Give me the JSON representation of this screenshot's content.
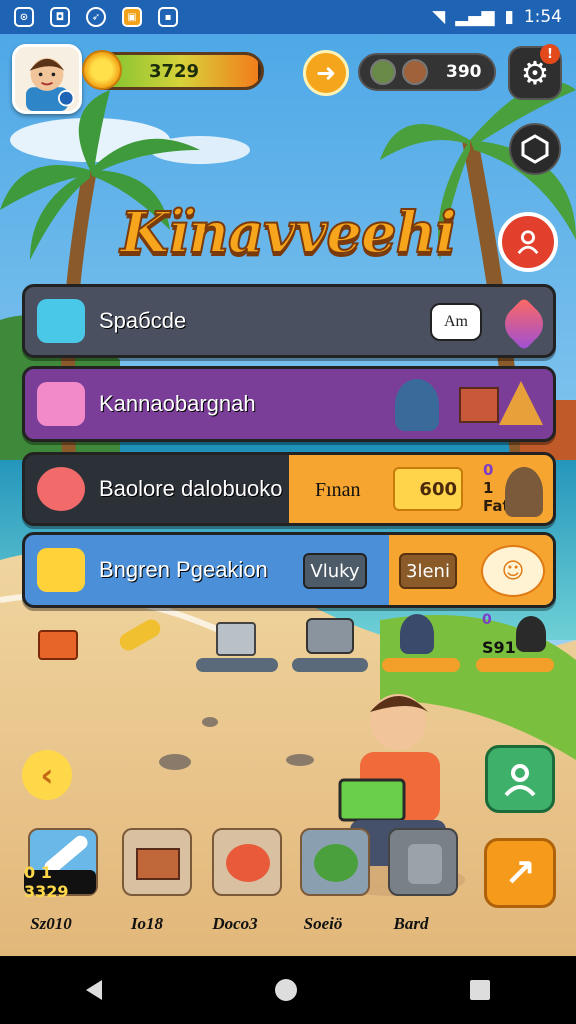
{
  "status_bar": {
    "time": "1:54"
  },
  "hud": {
    "xp_value": "3729",
    "xp_progress": 0.98,
    "friends_count": "390",
    "settings_alert": "!"
  },
  "game_title": "Kïnavveehi",
  "menu": [
    {
      "label": "Spaбcde",
      "badge": "Am"
    },
    {
      "label": "Kannaobargnah"
    },
    {
      "label": "Baolore dalobuoko",
      "right_text": "Fınan",
      "badge": "600",
      "small_top": "0",
      "small_mid": "1",
      "small_bottom": "Fat"
    },
    {
      "label": "Bngren Pgeakion",
      "chip1": "Vluky",
      "chip2": "3leni"
    }
  ],
  "shelf": {
    "small_top": "0",
    "small_value": "S91"
  },
  "dock": {
    "coin_value": "0 1 3329",
    "labels": [
      "Sz010",
      "Io18",
      "Doco3",
      "Soeiö",
      "Bard"
    ]
  },
  "colors": {
    "accent": "#f5a530",
    "status_bar": "#1f63b4",
    "title": "#f6a51c",
    "menu_purple": "#7a3e98",
    "menu_blue": "#4a8fd8"
  },
  "icons": [
    "avatar-icon",
    "sun-icon",
    "lightning-icon",
    "gear-icon",
    "hexagon-icon",
    "person-icon",
    "back-chevron-icon",
    "share-arrow-icon"
  ]
}
